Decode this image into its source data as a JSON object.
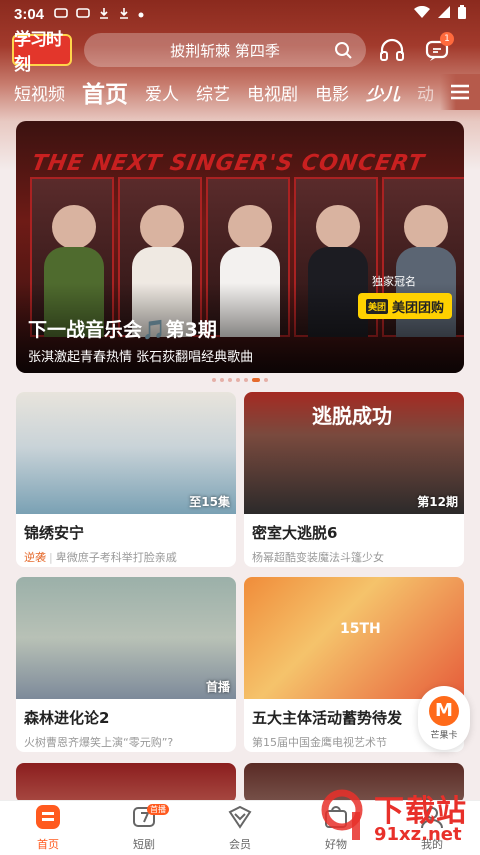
{
  "status_bar": {
    "time": "3:04"
  },
  "header": {
    "logo_text": "学习时刻",
    "search_placeholder": "披荆斩棘 第四季",
    "message_badge": "1"
  },
  "nav": {
    "tabs": [
      "短视频",
      "首页",
      "爱人",
      "综艺",
      "电视剧",
      "电影",
      "少儿",
      "动"
    ],
    "active_index": 1
  },
  "banner": {
    "art_title": "THE NEXT SINGER'S CONCERT",
    "title": "下一战音乐会🎵第3期",
    "subtitle": "张淇激起青春热情 张石荻翻唱经典歌曲",
    "sponsor_label": "独家冠名",
    "sponsor_logo": "美团",
    "sponsor_name": "美团团购"
  },
  "cards": [
    {
      "title": "锦绣安宁",
      "tag": "至15集",
      "sub_highlight": "逆袭",
      "sub": "卑微庶子考科举打脸亲戚"
    },
    {
      "title": "密室大逃脱6",
      "tag": "第12期",
      "sub_highlight": "",
      "sub": "杨幂超酷变装魔法斗篷少女",
      "thumb_text": "逃脱成功"
    },
    {
      "title": "森林进化论2",
      "tag": "首播",
      "sub_highlight": "",
      "sub": "火树曹恩齐爆笑上演“零元购”?"
    },
    {
      "title": "五大主体活动蓄势待发",
      "tag": "",
      "sub_highlight": "",
      "sub": "第15届中国金鹰电视艺术节",
      "thumb_text": "15TH"
    }
  ],
  "float_button": {
    "logo": "M",
    "label": "芒果卡"
  },
  "tabbar": [
    {
      "label": "首页",
      "icon": "home-icon"
    },
    {
      "label": "短剧",
      "icon": "short-drama-icon",
      "badge": "首播"
    },
    {
      "label": "会员",
      "icon": "vip-icon"
    },
    {
      "label": "好物",
      "icon": "shop-icon"
    },
    {
      "label": "我的",
      "icon": "profile-icon"
    }
  ],
  "watermark": {
    "line1": "下载站",
    "line2": "91xz.net"
  },
  "colors": {
    "accent": "#ff5a1f",
    "header_red": "#a23a2c"
  }
}
